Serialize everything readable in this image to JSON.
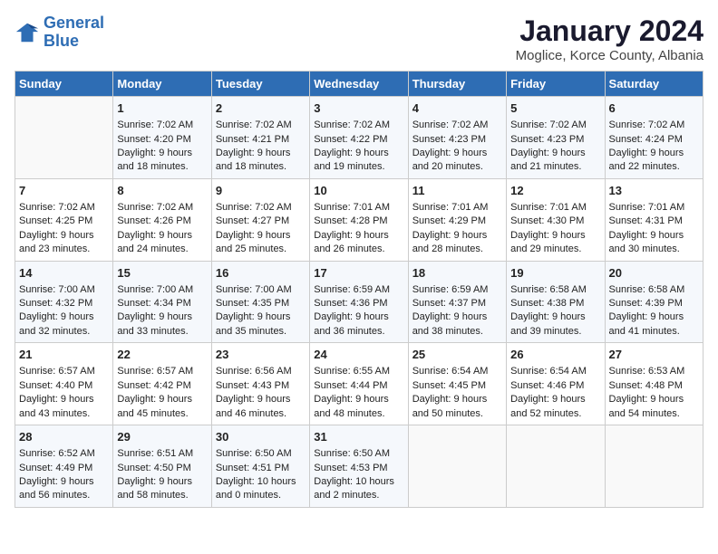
{
  "header": {
    "logo_line1": "General",
    "logo_line2": "Blue",
    "title": "January 2024",
    "subtitle": "Moglice, Korce County, Albania"
  },
  "columns": [
    "Sunday",
    "Monday",
    "Tuesday",
    "Wednesday",
    "Thursday",
    "Friday",
    "Saturday"
  ],
  "weeks": [
    [
      {
        "day": "",
        "sunrise": "",
        "sunset": "",
        "daylight": ""
      },
      {
        "day": "1",
        "sunrise": "Sunrise: 7:02 AM",
        "sunset": "Sunset: 4:20 PM",
        "daylight": "Daylight: 9 hours and 18 minutes."
      },
      {
        "day": "2",
        "sunrise": "Sunrise: 7:02 AM",
        "sunset": "Sunset: 4:21 PM",
        "daylight": "Daylight: 9 hours and 18 minutes."
      },
      {
        "day": "3",
        "sunrise": "Sunrise: 7:02 AM",
        "sunset": "Sunset: 4:22 PM",
        "daylight": "Daylight: 9 hours and 19 minutes."
      },
      {
        "day": "4",
        "sunrise": "Sunrise: 7:02 AM",
        "sunset": "Sunset: 4:23 PM",
        "daylight": "Daylight: 9 hours and 20 minutes."
      },
      {
        "day": "5",
        "sunrise": "Sunrise: 7:02 AM",
        "sunset": "Sunset: 4:23 PM",
        "daylight": "Daylight: 9 hours and 21 minutes."
      },
      {
        "day": "6",
        "sunrise": "Sunrise: 7:02 AM",
        "sunset": "Sunset: 4:24 PM",
        "daylight": "Daylight: 9 hours and 22 minutes."
      }
    ],
    [
      {
        "day": "7",
        "sunrise": "Sunrise: 7:02 AM",
        "sunset": "Sunset: 4:25 PM",
        "daylight": "Daylight: 9 hours and 23 minutes."
      },
      {
        "day": "8",
        "sunrise": "Sunrise: 7:02 AM",
        "sunset": "Sunset: 4:26 PM",
        "daylight": "Daylight: 9 hours and 24 minutes."
      },
      {
        "day": "9",
        "sunrise": "Sunrise: 7:02 AM",
        "sunset": "Sunset: 4:27 PM",
        "daylight": "Daylight: 9 hours and 25 minutes."
      },
      {
        "day": "10",
        "sunrise": "Sunrise: 7:01 AM",
        "sunset": "Sunset: 4:28 PM",
        "daylight": "Daylight: 9 hours and 26 minutes."
      },
      {
        "day": "11",
        "sunrise": "Sunrise: 7:01 AM",
        "sunset": "Sunset: 4:29 PM",
        "daylight": "Daylight: 9 hours and 28 minutes."
      },
      {
        "day": "12",
        "sunrise": "Sunrise: 7:01 AM",
        "sunset": "Sunset: 4:30 PM",
        "daylight": "Daylight: 9 hours and 29 minutes."
      },
      {
        "day": "13",
        "sunrise": "Sunrise: 7:01 AM",
        "sunset": "Sunset: 4:31 PM",
        "daylight": "Daylight: 9 hours and 30 minutes."
      }
    ],
    [
      {
        "day": "14",
        "sunrise": "Sunrise: 7:00 AM",
        "sunset": "Sunset: 4:32 PM",
        "daylight": "Daylight: 9 hours and 32 minutes."
      },
      {
        "day": "15",
        "sunrise": "Sunrise: 7:00 AM",
        "sunset": "Sunset: 4:34 PM",
        "daylight": "Daylight: 9 hours and 33 minutes."
      },
      {
        "day": "16",
        "sunrise": "Sunrise: 7:00 AM",
        "sunset": "Sunset: 4:35 PM",
        "daylight": "Daylight: 9 hours and 35 minutes."
      },
      {
        "day": "17",
        "sunrise": "Sunrise: 6:59 AM",
        "sunset": "Sunset: 4:36 PM",
        "daylight": "Daylight: 9 hours and 36 minutes."
      },
      {
        "day": "18",
        "sunrise": "Sunrise: 6:59 AM",
        "sunset": "Sunset: 4:37 PM",
        "daylight": "Daylight: 9 hours and 38 minutes."
      },
      {
        "day": "19",
        "sunrise": "Sunrise: 6:58 AM",
        "sunset": "Sunset: 4:38 PM",
        "daylight": "Daylight: 9 hours and 39 minutes."
      },
      {
        "day": "20",
        "sunrise": "Sunrise: 6:58 AM",
        "sunset": "Sunset: 4:39 PM",
        "daylight": "Daylight: 9 hours and 41 minutes."
      }
    ],
    [
      {
        "day": "21",
        "sunrise": "Sunrise: 6:57 AM",
        "sunset": "Sunset: 4:40 PM",
        "daylight": "Daylight: 9 hours and 43 minutes."
      },
      {
        "day": "22",
        "sunrise": "Sunrise: 6:57 AM",
        "sunset": "Sunset: 4:42 PM",
        "daylight": "Daylight: 9 hours and 45 minutes."
      },
      {
        "day": "23",
        "sunrise": "Sunrise: 6:56 AM",
        "sunset": "Sunset: 4:43 PM",
        "daylight": "Daylight: 9 hours and 46 minutes."
      },
      {
        "day": "24",
        "sunrise": "Sunrise: 6:55 AM",
        "sunset": "Sunset: 4:44 PM",
        "daylight": "Daylight: 9 hours and 48 minutes."
      },
      {
        "day": "25",
        "sunrise": "Sunrise: 6:54 AM",
        "sunset": "Sunset: 4:45 PM",
        "daylight": "Daylight: 9 hours and 50 minutes."
      },
      {
        "day": "26",
        "sunrise": "Sunrise: 6:54 AM",
        "sunset": "Sunset: 4:46 PM",
        "daylight": "Daylight: 9 hours and 52 minutes."
      },
      {
        "day": "27",
        "sunrise": "Sunrise: 6:53 AM",
        "sunset": "Sunset: 4:48 PM",
        "daylight": "Daylight: 9 hours and 54 minutes."
      }
    ],
    [
      {
        "day": "28",
        "sunrise": "Sunrise: 6:52 AM",
        "sunset": "Sunset: 4:49 PM",
        "daylight": "Daylight: 9 hours and 56 minutes."
      },
      {
        "day": "29",
        "sunrise": "Sunrise: 6:51 AM",
        "sunset": "Sunset: 4:50 PM",
        "daylight": "Daylight: 9 hours and 58 minutes."
      },
      {
        "day": "30",
        "sunrise": "Sunrise: 6:50 AM",
        "sunset": "Sunset: 4:51 PM",
        "daylight": "Daylight: 10 hours and 0 minutes."
      },
      {
        "day": "31",
        "sunrise": "Sunrise: 6:50 AM",
        "sunset": "Sunset: 4:53 PM",
        "daylight": "Daylight: 10 hours and 2 minutes."
      },
      {
        "day": "",
        "sunrise": "",
        "sunset": "",
        "daylight": ""
      },
      {
        "day": "",
        "sunrise": "",
        "sunset": "",
        "daylight": ""
      },
      {
        "day": "",
        "sunrise": "",
        "sunset": "",
        "daylight": ""
      }
    ]
  ]
}
